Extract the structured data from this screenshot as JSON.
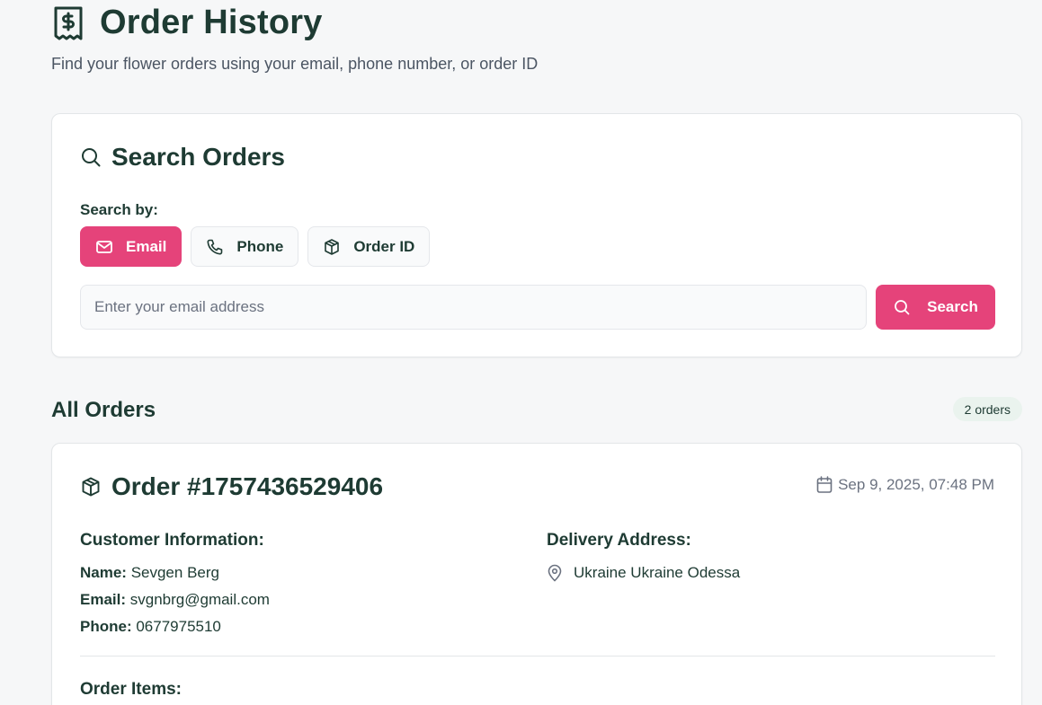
{
  "header": {
    "title": "Order History",
    "subtitle": "Find your flower orders using your email, phone number, or order ID",
    "icon": "receipt-dollar-icon"
  },
  "search": {
    "title": "Search Orders",
    "icon": "search-icon",
    "search_by_label": "Search by:",
    "tabs": [
      {
        "label": "Email",
        "icon": "mail-icon",
        "active": true
      },
      {
        "label": "Phone",
        "icon": "phone-icon",
        "active": false
      },
      {
        "label": "Order ID",
        "icon": "package-icon",
        "active": false
      }
    ],
    "placeholder": "Enter your email address",
    "value": "",
    "button_label": "Search"
  },
  "orders": {
    "title": "All Orders",
    "count_label": "2 orders",
    "items": [
      {
        "title": "Order #1757436529406",
        "date": "Sep 9, 2025, 07:48 PM",
        "customer_heading": "Customer Information:",
        "name_label": "Name:",
        "name": "Sevgen Berg",
        "email_label": "Email:",
        "email": "svgnbrg@gmail.com",
        "phone_label": "Phone:",
        "phone": "0677975510",
        "address_heading": "Delivery Address:",
        "address": "Ukraine Ukraine Odessa",
        "items_heading": "Order Items:"
      }
    ]
  },
  "colors": {
    "accent": "#e5437a",
    "heading": "#1e3b33",
    "muted": "#6b7280",
    "badge_bg": "#eaf3ee"
  }
}
